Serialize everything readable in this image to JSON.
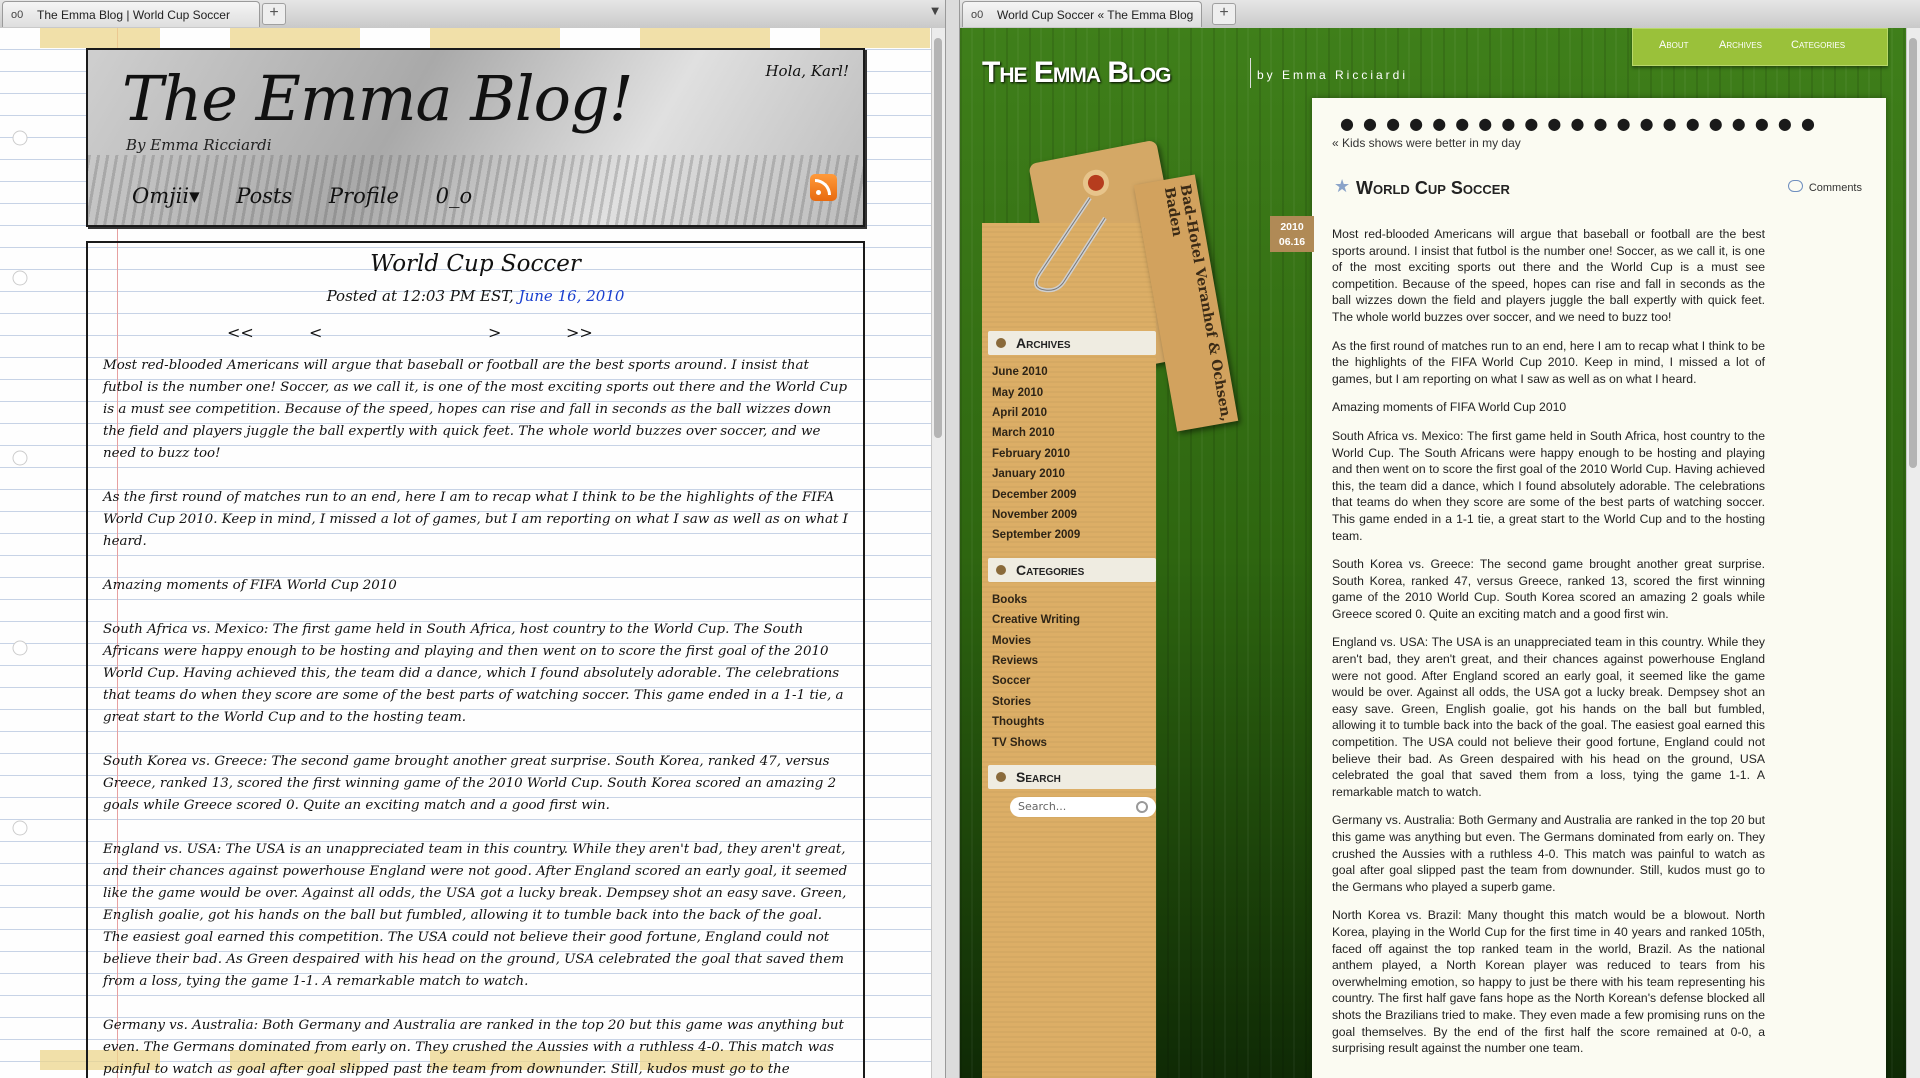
{
  "left_window": {
    "tab_title": "The Emma Blog | World Cup Soccer",
    "tab_icon": "o0",
    "new_tab": "+",
    "header": {
      "title": "The Emma Blog!",
      "byline": "By Emma Ricciardi",
      "greeting": "Hola, Karl!",
      "nav": [
        "Omjii▾",
        "Posts",
        "Profile",
        "0_o"
      ]
    },
    "post": {
      "title": "World Cup Soccer",
      "date_prefix": "Posted at 12:03 PM EST,",
      "date_month": "June",
      "date_day": "16,",
      "date_year": "2010",
      "nav_first": "<<",
      "nav_prev": "<",
      "nav_next": ">",
      "nav_last": ">>",
      "paragraphs": [
        "Most red-blooded Americans will argue that baseball or football are the best sports around.  I insist that futbol is the number one!  Soccer, as we call it, is one of the most exciting sports out there and the World Cup is a must see competition.  Because of the speed, hopes can rise and fall in seconds as the ball wizzes down the field and players juggle the ball expertly with quick feet.  The whole world buzzes over soccer, and we need to buzz too!",
        "As the first round of matches run to an end, here I am to recap what I think to be the highlights of the FIFA World Cup 2010.  Keep in mind, I missed a lot of games, but I am reporting on what I saw as well as on what I heard.",
        "Amazing moments of FIFA World Cup 2010",
        "South Africa vs. Mexico: The first game held in South Africa, host country to the World Cup.  The South Africans were happy enough to be hosting and playing and then went on to score the first goal of the 2010 World Cup.  Having achieved this, the team did a dance, which I found absolutely adorable.  The celebrations that teams do when they score are some of the best parts of watching soccer.  This game ended in a 1-1 tie, a great start to the World Cup and to the hosting team.",
        "South Korea vs. Greece: The second game brought another great surprise.  South Korea, ranked 47, versus Greece, ranked 13, scored the first winning game of the 2010 World Cup.  South Korea scored an amazing 2 goals while Greece scored 0.  Quite an exciting match and a good first win.",
        "England vs. USA: The USA is an unappreciated team in this country.  While they aren't bad, they aren't great, and their chances against powerhouse England were not good.  After England scored an early goal, it seemed like the game would be over.  Against all odds, the USA got a lucky break.  Dempsey shot an easy save.  Green, English goalie, got his hands on the ball but fumbled, allowing it to tumble back into the back of the goal.  The easiest goal earned this competition.  The USA could not believe their good fortune, England could not believe their bad.  As Green despaired with his head on the ground, USA celebrated the goal that saved them from a loss, tying the game 1-1.  A remarkable match to watch.",
        "Germany vs. Australia: Both Germany and Australia are ranked in the top 20 but this game was anything but even.  The Germans dominated from early on.  They crushed the Aussies with a ruthless 4-0.  This match was painful to watch as goal after goal slipped past the team from downunder.  Still, kudos must go to the Germans who played a superb game."
      ]
    }
  },
  "right_window": {
    "tab_title": "World Cup Soccer « The Emma Blog",
    "tab_icon": "o0",
    "new_tab": "+",
    "site_title": "The Emma Blog",
    "site_by": "by Emma Ricciardi",
    "nav": [
      "About",
      "Archives",
      "Categories"
    ],
    "tag_text": "Bad-Hotel Veranhof & Ochsen, Baden",
    "archives": {
      "title": "Archives",
      "items": [
        "June 2010",
        "May 2010",
        "April 2010",
        "March 2010",
        "February 2010",
        "January 2010",
        "December 2009",
        "November 2009",
        "September 2009"
      ]
    },
    "categories": {
      "title": "Categories",
      "items": [
        "Books",
        "Creative Writing",
        "Movies",
        "Reviews",
        "Soccer",
        "Stories",
        "Thoughts",
        "TV Shows"
      ]
    },
    "search": {
      "title": "Search",
      "placeholder": "Search..."
    },
    "post": {
      "prev_link": "« Kids shows were better in my day",
      "date_year": "2010",
      "date_md": "06.16",
      "title": "World Cup Soccer",
      "comments": "Comments",
      "paragraphs": [
        "Most red-blooded Americans will argue that baseball or football are the best sports around.  I insist that futbol is the number one!  Soccer, as we call it, is one of the most exciting sports out there and the World Cup is a must see competition.  Because of the speed, hopes can rise and fall in seconds as the ball wizzes down the field and players juggle the ball expertly with quick feet.  The whole world buzzes over soccer, and we need to buzz too!",
        "As the first round of matches run to an end, here I am to recap what I think to be the highlights of the FIFA World Cup 2010.  Keep in mind, I missed a lot of games, but I am reporting on what I saw as well as on what I heard.",
        "Amazing moments of FIFA World Cup 2010",
        "South Africa vs. Mexico: The first game held in South Africa, host country to the World Cup.  The South Africans were happy enough to be hosting and playing and then went on to score the first goal of the 2010 World Cup.  Having achieved this, the team did a dance, which I found absolutely adorable.  The celebrations that teams do when they score are some of the best parts of watching soccer.  This game ended in a 1-1 tie, a great start to the World Cup and to the hosting team.",
        "South Korea vs. Greece: The second game brought another great surprise.  South Korea, ranked 47, versus Greece, ranked 13, scored the first winning game of the 2010 World Cup.  South Korea scored an amazing 2 goals while Greece scored 0.  Quite an exciting match and a good first win.",
        "England vs. USA: The USA is an unappreciated team in this country.  While they aren't bad, they aren't great, and their chances against powerhouse England were not good.  After England scored an early goal, it seemed like the game would be over.  Against all odds, the USA got a lucky break.  Dempsey shot an easy save.  Green, English goalie, got his hands on the ball but fumbled, allowing it to tumble back into the back of the goal.  The easiest goal earned this competition.  The USA could not believe their good fortune, England could not believe their bad.  As Green despaired with his head on the ground, USA celebrated the goal that saved them from a loss, tying the game 1-1.  A remarkable match to watch.",
        "Germany vs. Australia: Both Germany and Australia are ranked in the top 20 but this game was anything but even.  The Germans dominated from early on.  They crushed the Aussies with a ruthless 4-0.  This match was painful to watch as goal after goal slipped past the team from downunder.  Still, kudos must go to the Germans who played a superb game.",
        "North Korea vs. Brazil: Many thought this match would be a blowout.  North Korea, playing in the World Cup for the first time in 40 years and ranked 105th, faced off against the top ranked team in the world, Brazil.  As the national anthem played, a North Korean player was reduced to tears from his overwhelming emotion, so happy to just be there with his team representing his country.  The first half gave fans hope as the North Korean's defense blocked all shots the Brazilians tried to make.  They even made a few promising runs on the goal themselves.  By the end of the first half the score remained at 0-0, a surprising result against the number one team."
      ]
    }
  },
  "colors": {
    "rss_orange": "#f07d1e",
    "topnav_green": "#9ac13a",
    "date_link_blue": "#1a3fcf",
    "sidebar_kraft": "#dcae66"
  }
}
